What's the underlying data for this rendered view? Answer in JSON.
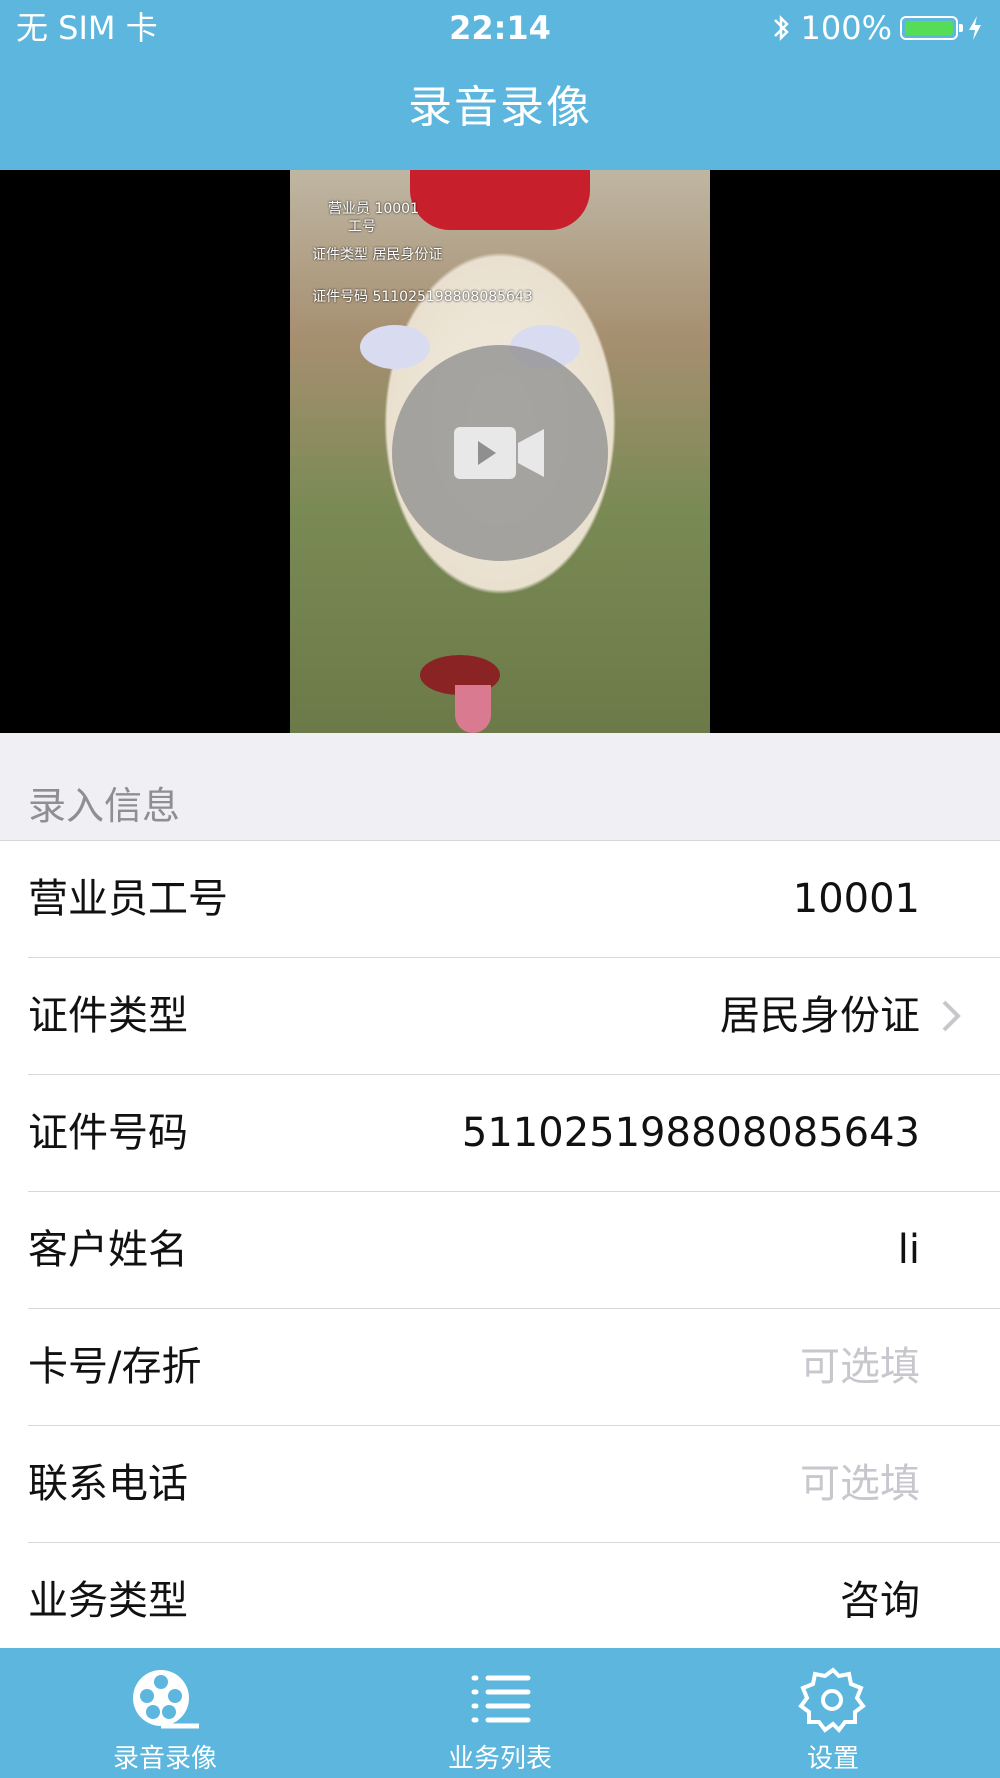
{
  "status_bar": {
    "carrier": "无 SIM 卡",
    "time": "22:14",
    "battery_percent": "100%"
  },
  "header": {
    "title": "录音录像"
  },
  "video": {
    "overlay_lines": [
      "营业员 10001",
      "工号",
      "证件类型 居民身份证",
      "证件号码 511025198808085643"
    ],
    "play_icon": "video-camera-icon"
  },
  "section": {
    "label": "录入信息"
  },
  "rows": [
    {
      "label": "营业员工号",
      "value": "10001"
    },
    {
      "label": "证件类型",
      "value": "居民身份证"
    },
    {
      "label": "证件号码",
      "value": "511025198808085643"
    },
    {
      "label": "客户姓名",
      "value": "li"
    },
    {
      "label": "卡号/存折",
      "placeholder": "可选填"
    },
    {
      "label": "联系电话",
      "placeholder": "可选填"
    },
    {
      "label": "业务类型",
      "value": "咨询"
    }
  ],
  "tabbar": {
    "tabs": [
      {
        "label": "录音录像",
        "icon": "film-reel-icon"
      },
      {
        "label": "业务列表",
        "icon": "list-icon"
      },
      {
        "label": "设置",
        "icon": "gear-icon"
      }
    ]
  },
  "colors": {
    "primary": "#5cb6dd",
    "battery": "#55dd55",
    "placeholder": "#c7c7cd"
  }
}
